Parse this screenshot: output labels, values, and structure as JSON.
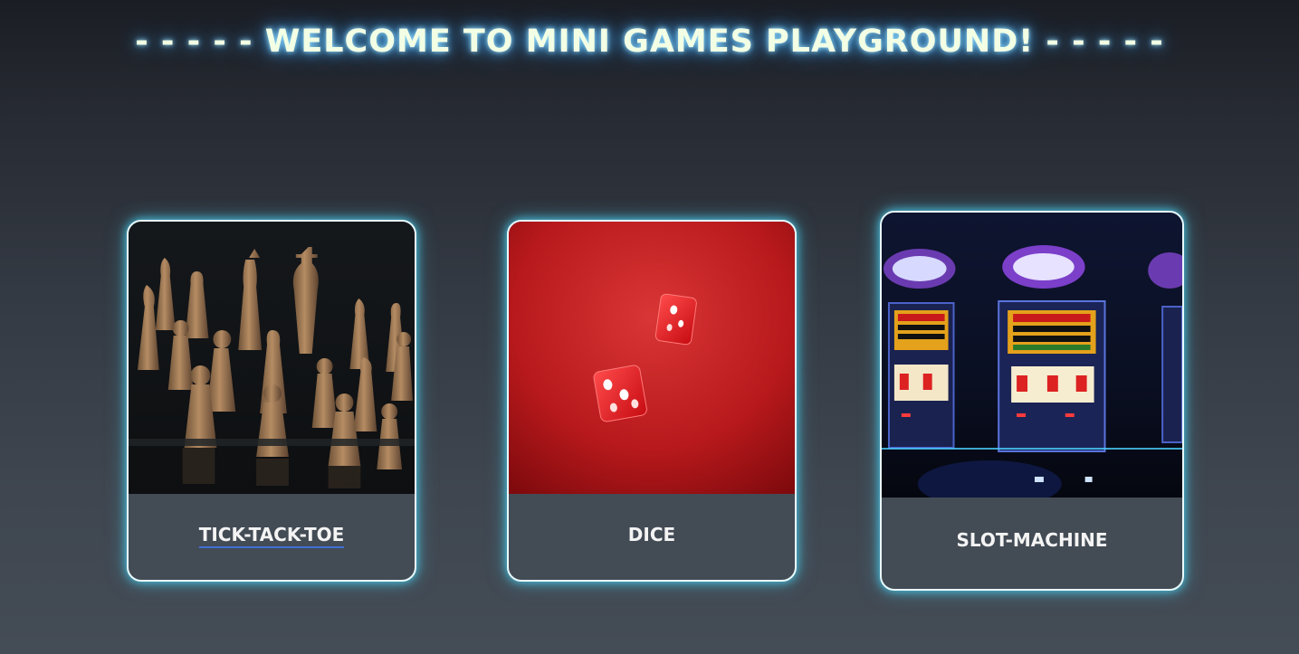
{
  "header": {
    "title": "- - - - - WELCOME TO MINI GAMES PLAYGROUND! - - - - -"
  },
  "games": [
    {
      "label": "TICK-TACK-TOE",
      "image": "chess-pieces-image"
    },
    {
      "label": "DICE",
      "image": "red-dice-image"
    },
    {
      "label": "SLOT-MACHINE",
      "image": "slot-machines-image"
    }
  ],
  "colors": {
    "title_text": "#f2ffe4",
    "title_glow": "#4fb6ff",
    "card_border": "#e9fbff",
    "card_glow": "#49c6e5",
    "card_footer": "#434b55",
    "link_underline": "#3e6fd6"
  }
}
